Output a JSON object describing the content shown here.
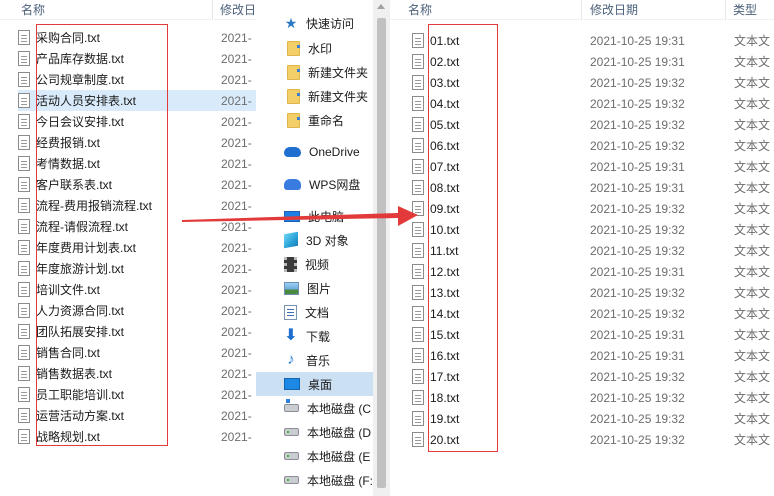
{
  "left_pane": {
    "header": {
      "name": "名称",
      "date": "修改日"
    },
    "files": [
      {
        "name": "采购合同.txt",
        "date": "2021-"
      },
      {
        "name": "产品库存数据.txt",
        "date": "2021-"
      },
      {
        "name": "公司规章制度.txt",
        "date": "2021-"
      },
      {
        "name": "活动人员安排表.txt",
        "date": "2021-",
        "selected": true
      },
      {
        "name": "今日会议安排.txt",
        "date": "2021-"
      },
      {
        "name": "经费报销.txt",
        "date": "2021-"
      },
      {
        "name": "考情数据.txt",
        "date": "2021-"
      },
      {
        "name": "客户联系表.txt",
        "date": "2021-"
      },
      {
        "name": "流程-费用报销流程.txt",
        "date": "2021-"
      },
      {
        "name": "流程-请假流程.txt",
        "date": "2021-"
      },
      {
        "name": "年度费用计划表.txt",
        "date": "2021-"
      },
      {
        "name": "年度旅游计划.txt",
        "date": "2021-"
      },
      {
        "name": "培训文件.txt",
        "date": "2021-"
      },
      {
        "name": "人力资源合同.txt",
        "date": "2021-"
      },
      {
        "name": "团队拓展安排.txt",
        "date": "2021-"
      },
      {
        "name": "销售合同.txt",
        "date": "2021-"
      },
      {
        "name": "销售数据表.txt",
        "date": "2021-"
      },
      {
        "name": "员工职能培训.txt",
        "date": "2021-"
      },
      {
        "name": "运营活动方案.txt",
        "date": "2021-"
      },
      {
        "name": "战略规划.txt",
        "date": "2021-"
      }
    ]
  },
  "nav_pane": {
    "items": [
      {
        "label": "快速访问",
        "icon": "star-icon"
      },
      {
        "label": "水印",
        "icon": "folder-icon"
      },
      {
        "label": "新建文件夹",
        "icon": "folder-icon"
      },
      {
        "label": "新建文件夹",
        "icon": "folder-icon"
      },
      {
        "label": "重命名",
        "icon": "folder-icon"
      },
      {
        "label": "OneDrive",
        "icon": "onedrive-icon"
      },
      {
        "label": "WPS网盘",
        "icon": "wps-cloud-icon"
      },
      {
        "label": "此电脑",
        "icon": "this-pc-icon"
      },
      {
        "label": "3D 对象",
        "icon": "3d-objects-icon"
      },
      {
        "label": "视频",
        "icon": "video-icon"
      },
      {
        "label": "图片",
        "icon": "pictures-icon"
      },
      {
        "label": "文档",
        "icon": "documents-icon"
      },
      {
        "label": "下载",
        "icon": "download-icon"
      },
      {
        "label": "音乐",
        "icon": "music-icon"
      },
      {
        "label": "桌面",
        "icon": "desktop-icon",
        "selected": true
      },
      {
        "label": "本地磁盘 (C",
        "icon": "local-disk-c-icon"
      },
      {
        "label": "本地磁盘 (D",
        "icon": "local-disk-icon"
      },
      {
        "label": "本地磁盘 (E",
        "icon": "local-disk-icon"
      },
      {
        "label": "本地磁盘 (F:",
        "icon": "local-disk-icon"
      }
    ]
  },
  "right_pane": {
    "header": {
      "name": "名称",
      "date": "修改日期",
      "type": "类型"
    },
    "files": [
      {
        "name": "01.txt",
        "date": "2021-10-25 19:31",
        "type": "文本文"
      },
      {
        "name": "02.txt",
        "date": "2021-10-25 19:31",
        "type": "文本文"
      },
      {
        "name": "03.txt",
        "date": "2021-10-25 19:32",
        "type": "文本文"
      },
      {
        "name": "04.txt",
        "date": "2021-10-25 19:32",
        "type": "文本文"
      },
      {
        "name": "05.txt",
        "date": "2021-10-25 19:32",
        "type": "文本文"
      },
      {
        "name": "06.txt",
        "date": "2021-10-25 19:32",
        "type": "文本文"
      },
      {
        "name": "07.txt",
        "date": "2021-10-25 19:31",
        "type": "文本文"
      },
      {
        "name": "08.txt",
        "date": "2021-10-25 19:31",
        "type": "文本文"
      },
      {
        "name": "09.txt",
        "date": "2021-10-25 19:32",
        "type": "文本文"
      },
      {
        "name": "10.txt",
        "date": "2021-10-25 19:32",
        "type": "文本文"
      },
      {
        "name": "11.txt",
        "date": "2021-10-25 19:32",
        "type": "文本文"
      },
      {
        "name": "12.txt",
        "date": "2021-10-25 19:31",
        "type": "文本文"
      },
      {
        "name": "13.txt",
        "date": "2021-10-25 19:32",
        "type": "文本文"
      },
      {
        "name": "14.txt",
        "date": "2021-10-25 19:32",
        "type": "文本文"
      },
      {
        "name": "15.txt",
        "date": "2021-10-25 19:31",
        "type": "文本文"
      },
      {
        "name": "16.txt",
        "date": "2021-10-25 19:31",
        "type": "文本文"
      },
      {
        "name": "17.txt",
        "date": "2021-10-25 19:32",
        "type": "文本文"
      },
      {
        "name": "18.txt",
        "date": "2021-10-25 19:32",
        "type": "文本文"
      },
      {
        "name": "19.txt",
        "date": "2021-10-25 19:32",
        "type": "文本文"
      },
      {
        "name": "20.txt",
        "date": "2021-10-25 19:32",
        "type": "文本文"
      }
    ]
  },
  "colors": {
    "highlight_box": "#e23a3a",
    "selection": "#d9ebfb",
    "nav_selection": "#cce0f4",
    "header_text": "#4c607a"
  }
}
